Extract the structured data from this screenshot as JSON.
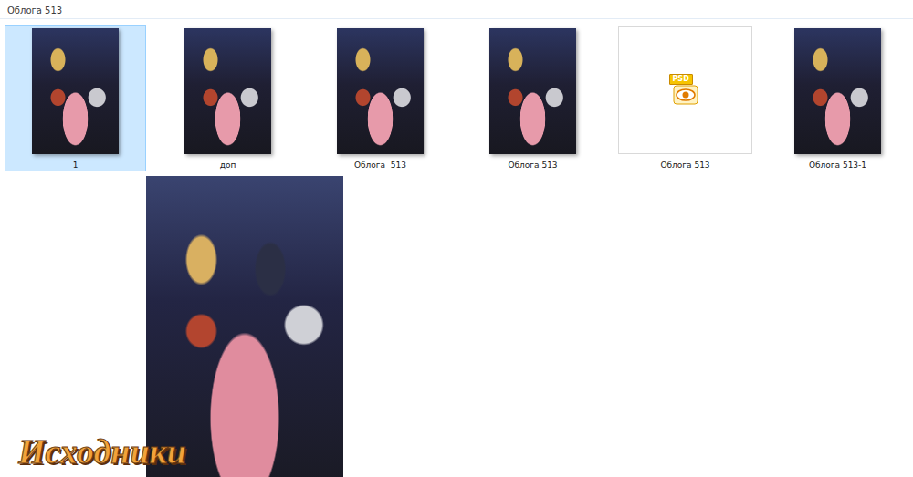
{
  "window": {
    "title": "Облога 513"
  },
  "files": [
    {
      "name": "1",
      "kind": "image",
      "selected": true
    },
    {
      "name": "доп",
      "kind": "image",
      "selected": false
    },
    {
      "name": "Облога  513",
      "kind": "image",
      "selected": false
    },
    {
      "name": "Облога 513",
      "kind": "image",
      "selected": false
    },
    {
      "name": "Облога 513",
      "kind": "psd",
      "badge": "PSD",
      "selected": false
    },
    {
      "name": "Облога 513-1",
      "kind": "image",
      "selected": false
    }
  ],
  "watermark": "Исходники"
}
